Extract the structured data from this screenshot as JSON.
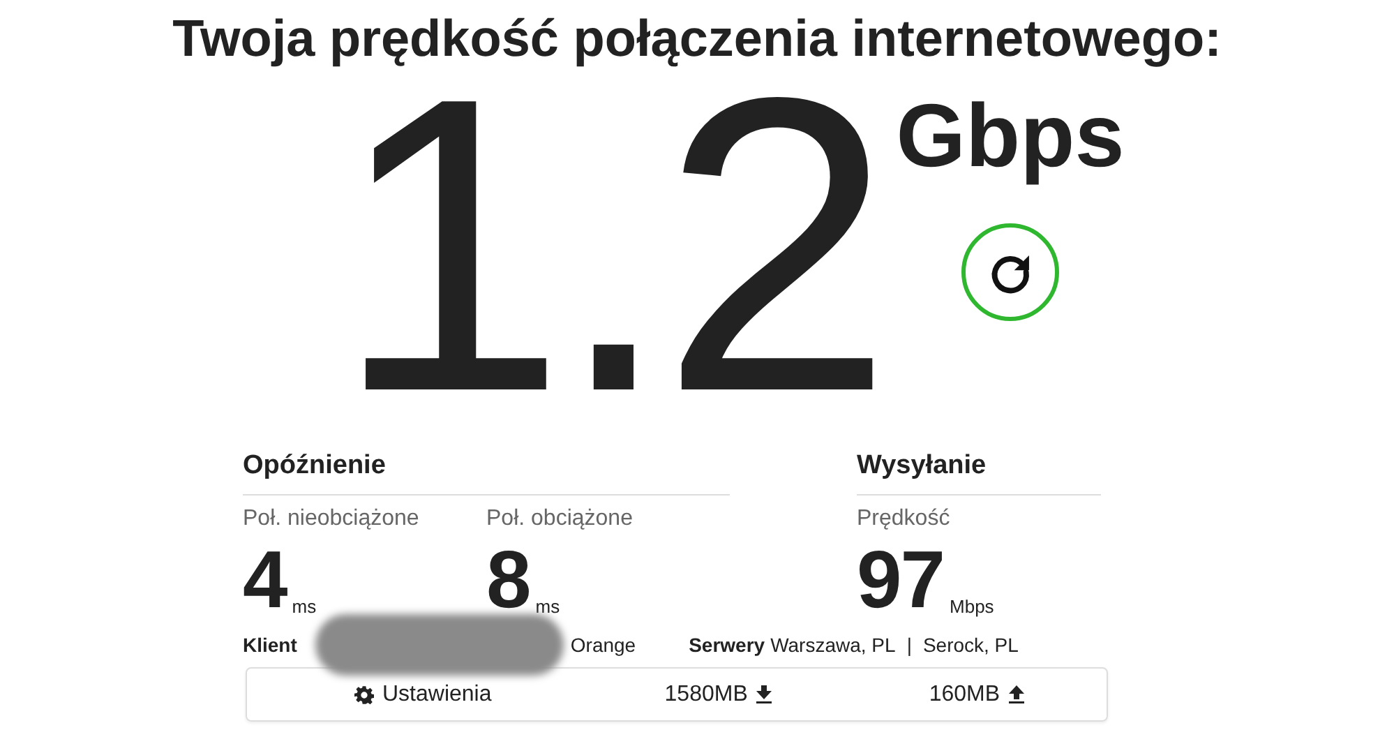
{
  "title": "Twoja prędkość połączenia internetowego:",
  "speed": {
    "value": "1.2",
    "unit": "Gbps"
  },
  "latency": {
    "heading": "Opóźnienie",
    "metrics": [
      {
        "label": "Poł. nieobciążone",
        "value": "4",
        "unit": "ms"
      },
      {
        "label": "Poł. obciążone",
        "value": "8",
        "unit": "ms"
      }
    ]
  },
  "upload": {
    "heading": "Wysyłanie",
    "metrics": [
      {
        "label": "Prędkość",
        "value": "97",
        "unit": "Mbps"
      }
    ]
  },
  "client": {
    "label": "Klient",
    "isp": "Orange"
  },
  "servers": {
    "label": "Serwery",
    "items": [
      "Warszawa, PL",
      "Serock, PL"
    ],
    "separator": "|"
  },
  "footer": {
    "settings": "Ustawienia",
    "download": "1580MB",
    "upload": "160MB"
  }
}
